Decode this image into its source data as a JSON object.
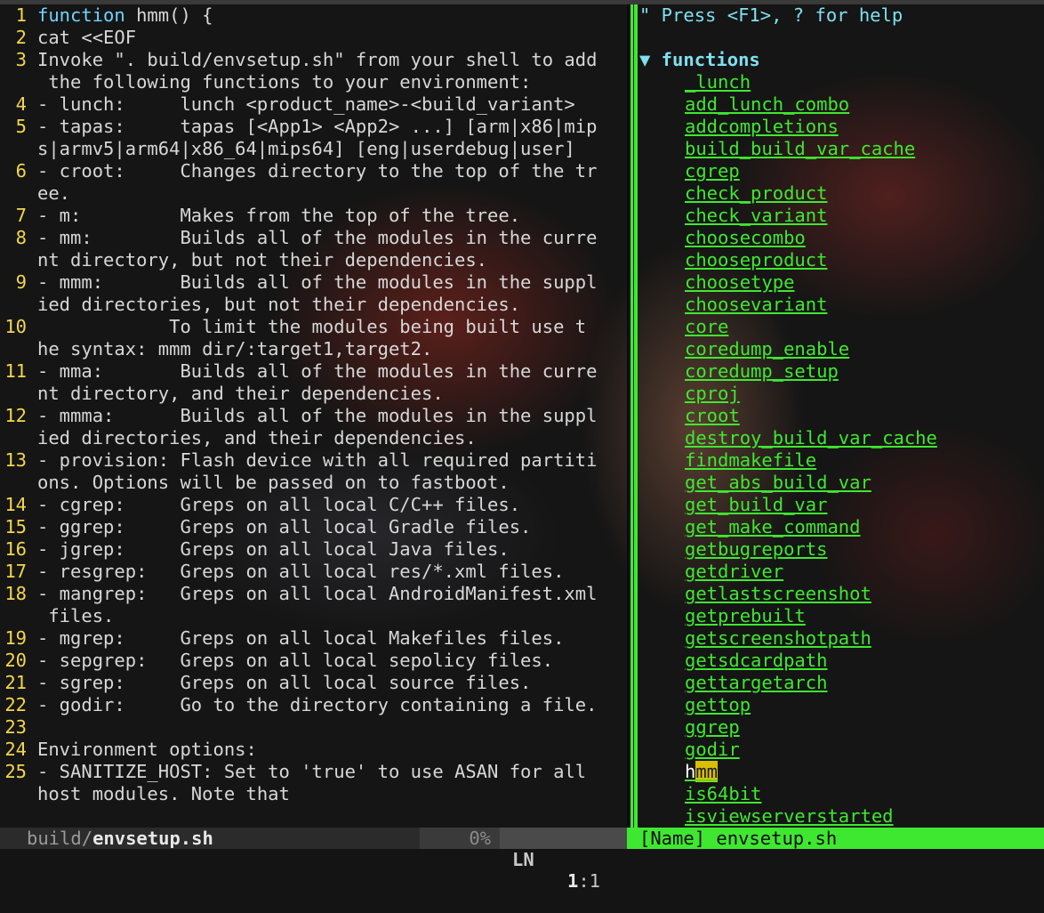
{
  "editor": {
    "lines": [
      {
        "n": "1",
        "text": "function hmm() {",
        "keyword": "function"
      },
      {
        "n": "2",
        "text": "cat <<EOF"
      },
      {
        "n": "3",
        "text": "Invoke \". build/envsetup.sh\" from your shell to add"
      },
      {
        "n": "",
        "text": " the following functions to your environment:"
      },
      {
        "n": "4",
        "text": "- lunch:     lunch <product_name>-<build_variant>"
      },
      {
        "n": "5",
        "text": "- tapas:     tapas [<App1> <App2> ...] [arm|x86|mip"
      },
      {
        "n": "",
        "text": "s|armv5|arm64|x86_64|mips64] [eng|userdebug|user]"
      },
      {
        "n": "6",
        "text": "- croot:     Changes directory to the top of the tr"
      },
      {
        "n": "",
        "text": "ee."
      },
      {
        "n": "7",
        "text": "- m:         Makes from the top of the tree."
      },
      {
        "n": "8",
        "text": "- mm:        Builds all of the modules in the curre"
      },
      {
        "n": "",
        "text": "nt directory, but not their dependencies."
      },
      {
        "n": "9",
        "text": "- mmm:       Builds all of the modules in the suppl"
      },
      {
        "n": "",
        "text": "ied directories, but not their dependencies."
      },
      {
        "n": "10",
        "text": "            To limit the modules being built use t"
      },
      {
        "n": "",
        "text": "he syntax: mmm dir/:target1,target2."
      },
      {
        "n": "11",
        "text": "- mma:       Builds all of the modules in the curre"
      },
      {
        "n": "",
        "text": "nt directory, and their dependencies."
      },
      {
        "n": "12",
        "text": "- mmma:      Builds all of the modules in the suppl"
      },
      {
        "n": "",
        "text": "ied directories, and their dependencies."
      },
      {
        "n": "13",
        "text": "- provision: Flash device with all required partiti"
      },
      {
        "n": "",
        "text": "ons. Options will be passed on to fastboot."
      },
      {
        "n": "14",
        "text": "- cgrep:     Greps on all local C/C++ files."
      },
      {
        "n": "15",
        "text": "- ggrep:     Greps on all local Gradle files."
      },
      {
        "n": "16",
        "text": "- jgrep:     Greps on all local Java files."
      },
      {
        "n": "17",
        "text": "- resgrep:   Greps on all local res/*.xml files."
      },
      {
        "n": "18",
        "text": "- mangrep:   Greps on all local AndroidManifest.xml"
      },
      {
        "n": "",
        "text": " files."
      },
      {
        "n": "19",
        "text": "- mgrep:     Greps on all local Makefiles files."
      },
      {
        "n": "20",
        "text": "- sepgrep:   Greps on all local sepolicy files."
      },
      {
        "n": "21",
        "text": "- sgrep:     Greps on all local source files."
      },
      {
        "n": "22",
        "text": "- godir:     Go to the directory containing a file."
      },
      {
        "n": "23",
        "text": ""
      },
      {
        "n": "24",
        "text": "Environment options:"
      },
      {
        "n": "25",
        "text": "- SANITIZE_HOST: Set to 'true' to use ASAN for all"
      },
      {
        "n": "",
        "text": "host modules. Note that"
      }
    ]
  },
  "tagbar": {
    "help": "\" Press <F1>, ? for help",
    "group": "▼ functions",
    "items": [
      "_lunch",
      "add_lunch_combo",
      "addcompletions",
      "build_build_var_cache",
      "cgrep",
      "check_product",
      "check_variant",
      "choosecombo",
      "chooseproduct",
      "choosetype",
      "choosevariant",
      "core",
      "coredump_enable",
      "coredump_setup",
      "cproj",
      "croot",
      "destroy_build_var_cache",
      "findmakefile",
      "get_abs_build_var",
      "get_build_var",
      "get_make_command",
      "getbugreports",
      "getdriver",
      "getlastscreenshot",
      "getprebuilt",
      "getscreenshotpath",
      "getsdcardpath",
      "gettargetarch",
      "gettop",
      "ggrep",
      "godir",
      "hmm",
      "is64bit",
      "isviewserverstarted"
    ],
    "selected": "hmm"
  },
  "statusline": {
    "dir": "build/",
    "file": "envsetup.sh",
    "percent": "0%",
    "ln_label": "LN",
    "line": "1",
    "col": ":1"
  },
  "tagbar_status": "[Name] envsetup.sh",
  "colors": {
    "linenumber": "#f2d64b",
    "keyword": "#6fd3ff",
    "tag": "#3fe830",
    "highlight": "#d8c000"
  }
}
